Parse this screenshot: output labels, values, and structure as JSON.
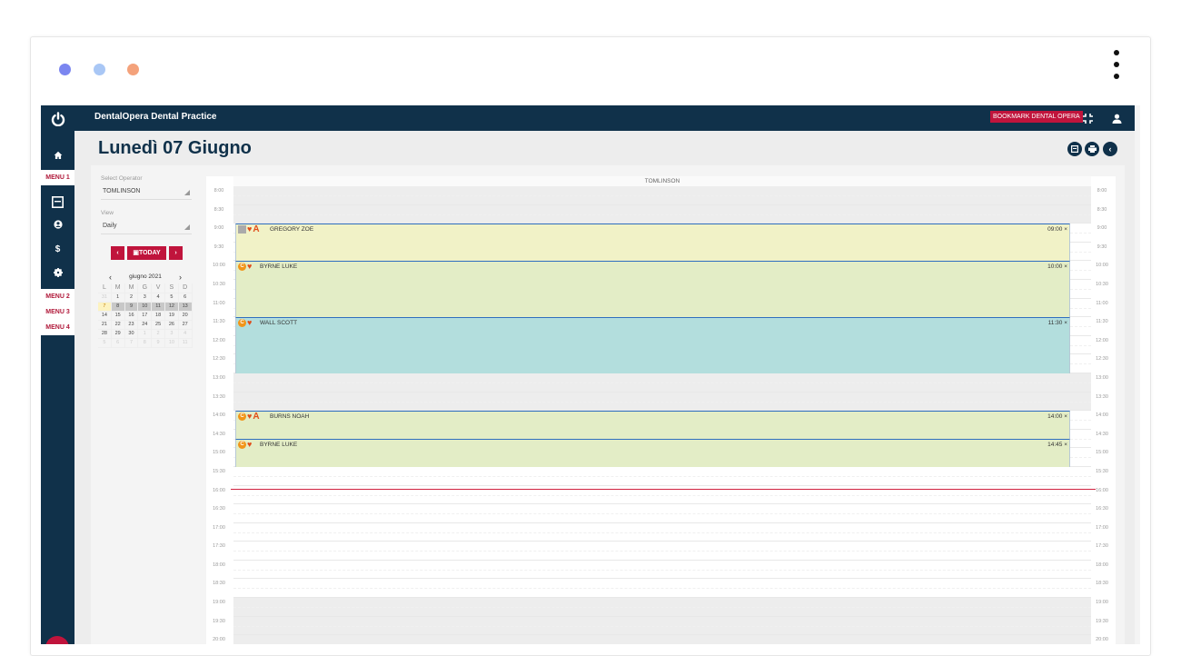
{
  "window": {
    "dots": [
      {
        "name": "window-dot-blue",
        "color": "#7b86f0"
      },
      {
        "name": "window-dot-lightblue",
        "color": "#a9c7f5"
      },
      {
        "name": "window-dot-orange",
        "color": "#f4a27b"
      }
    ]
  },
  "header": {
    "app_title": "DentalOpera Dental Practice",
    "bookmark_label": "BOOKMARK DENTAL OPERA"
  },
  "sidebar": {
    "menus": [
      "MENU 1",
      "MENU 2",
      "MENU 3",
      "MENU 4"
    ],
    "icons": [
      "home-icon",
      "calendar-icon",
      "user-icon",
      "dollar-icon",
      "gear-icon"
    ]
  },
  "page": {
    "title": "Lunedì 07 Giugno"
  },
  "filters": {
    "operator_label": "Select Operator",
    "operator_value": "TOMLINSON",
    "view_label": "View",
    "view_value": "Daily",
    "today_label": "TODAY"
  },
  "mini_calendar": {
    "month_label": "giugno 2021",
    "day_headers": [
      "L",
      "M",
      "M",
      "G",
      "V",
      "S",
      "D"
    ],
    "weeks": [
      [
        "31",
        "1",
        "2",
        "3",
        "4",
        "5",
        "6"
      ],
      [
        "7",
        "8",
        "9",
        "10",
        "11",
        "12",
        "13"
      ],
      [
        "14",
        "15",
        "16",
        "17",
        "18",
        "19",
        "20"
      ],
      [
        "21",
        "22",
        "23",
        "24",
        "25",
        "26",
        "27"
      ],
      [
        "28",
        "29",
        "30",
        "1",
        "2",
        "3",
        "4"
      ],
      [
        "5",
        "6",
        "7",
        "8",
        "9",
        "10",
        "11"
      ]
    ]
  },
  "schedule": {
    "operator_column": "TOMLINSON",
    "left_times": [
      "8:00",
      "8:30",
      "9:00",
      "9:30",
      "10:00",
      "10:30",
      "11:00",
      "11:30",
      "12:00",
      "12:30",
      "13:00",
      "13:30",
      "14:00",
      "14:30",
      "15:00",
      "15:30",
      "16:00",
      "16:30",
      "17:00",
      "17:30",
      "18:00",
      "18:30",
      "19:00",
      "19:30",
      "20:00"
    ],
    "right_times": [
      "8:00",
      "8:30",
      "9:00",
      "9:30",
      "10:00",
      "10:30",
      "11:00",
      "11:30",
      "12:00",
      "12:30",
      "13:00",
      "13:30",
      "14:00",
      "14:30",
      "15:00",
      "15:30",
      "16:00",
      "16:30",
      "17:00",
      "17:30",
      "18:00",
      "18:30",
      "19:00",
      "19:30",
      "20:00"
    ],
    "appointments": [
      {
        "patient": "GREGORY ZOE",
        "time": "09:00 ×",
        "color": "#f1f2c7"
      },
      {
        "patient": "BYRNE LUKE",
        "time": "10:00 ×",
        "color": "#e3edc6"
      },
      {
        "patient": "WALL SCOTT",
        "time": "11:30 ×",
        "color": "#b3dedd"
      },
      {
        "patient": "BURNS NOAH",
        "time": "14:00 ×",
        "color": "#e3edc6"
      },
      {
        "patient": "BYRNE LUKE",
        "time": "14:45 ×",
        "color": "#e3edc6"
      }
    ],
    "now_line_color": "#d0213f"
  },
  "colors": {
    "navy": "#10314a",
    "accent_red": "#c0143c"
  }
}
